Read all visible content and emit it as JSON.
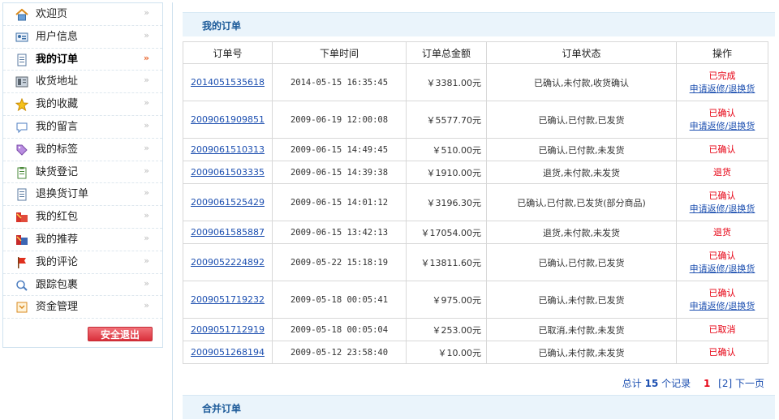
{
  "sidebar": {
    "items": [
      {
        "label": "欢迎页",
        "icon": "house-icon",
        "active": false
      },
      {
        "label": "用户信息",
        "icon": "id-card-icon",
        "active": false
      },
      {
        "label": "我的订单",
        "icon": "document-icon",
        "active": true
      },
      {
        "label": "收货地址",
        "icon": "address-book-icon",
        "active": false
      },
      {
        "label": "我的收藏",
        "icon": "star-icon",
        "active": false
      },
      {
        "label": "我的留言",
        "icon": "speech-bubble-icon",
        "active": false
      },
      {
        "label": "我的标签",
        "icon": "tag-icon",
        "active": false
      },
      {
        "label": "缺货登记",
        "icon": "clipboard-icon",
        "active": false
      },
      {
        "label": "退换货订单",
        "icon": "document-icon",
        "active": false
      },
      {
        "label": "我的红包",
        "icon": "red-envelope-icon",
        "active": false
      },
      {
        "label": "我的推荐",
        "icon": "recommend-icon",
        "active": false
      },
      {
        "label": "我的评论",
        "icon": "flag-icon",
        "active": false
      },
      {
        "label": "跟踪包裹",
        "icon": "tracking-icon",
        "active": false
      },
      {
        "label": "资金管理",
        "icon": "wallet-icon",
        "active": false
      }
    ],
    "logout_label": "安全退出"
  },
  "main": {
    "orders_title": "我的订单",
    "merge_title": "合并订单",
    "columns": [
      "订单号",
      "下单时间",
      "订单总金额",
      "订单状态",
      "操作"
    ],
    "rows": [
      {
        "id": "2014051535618",
        "time": "2014-05-15 16:35:45",
        "amount": "￥3381.00元",
        "status": "已确认,未付款,收货确认",
        "action": "已完成",
        "extra": "申请返修/退换货"
      },
      {
        "id": "2009061909851",
        "time": "2009-06-19 12:00:08",
        "amount": "￥5577.70元",
        "status": "已确认,已付款,已发货",
        "action": "已确认",
        "extra": "申请返修/退换货"
      },
      {
        "id": "2009061510313",
        "time": "2009-06-15 14:49:45",
        "amount": "￥510.00元",
        "status": "已确认,已付款,未发货",
        "action": "已确认",
        "extra": ""
      },
      {
        "id": "2009061503335",
        "time": "2009-06-15 14:39:38",
        "amount": "￥1910.00元",
        "status": "退货,未付款,未发货",
        "action": "退货",
        "extra": ""
      },
      {
        "id": "2009061525429",
        "time": "2009-06-15 14:01:12",
        "amount": "￥3196.30元",
        "status": "已确认,已付款,已发货(部分商品)",
        "action": "已确认",
        "extra": "申请返修/退换货"
      },
      {
        "id": "2009061585887",
        "time": "2009-06-15 13:42:13",
        "amount": "￥17054.00元",
        "status": "退货,未付款,未发货",
        "action": "退货",
        "extra": ""
      },
      {
        "id": "2009052224892",
        "time": "2009-05-22 15:18:19",
        "amount": "￥13811.60元",
        "status": "已确认,已付款,已发货",
        "action": "已确认",
        "extra": "申请返修/退换货"
      },
      {
        "id": "2009051719232",
        "time": "2009-05-18 00:05:41",
        "amount": "￥975.00元",
        "status": "已确认,未付款,已发货",
        "action": "已确认",
        "extra": "申请返修/退换货"
      },
      {
        "id": "2009051712919",
        "time": "2009-05-18 00:05:04",
        "amount": "￥253.00元",
        "status": "已取消,未付款,未发货",
        "action": "已取消",
        "extra": ""
      },
      {
        "id": "2009051268194",
        "time": "2009-05-12 23:58:40",
        "amount": "￥10.00元",
        "status": "已确认,未付款,未发货",
        "action": "已确认",
        "extra": ""
      }
    ],
    "pager": {
      "total_prefix": "总计",
      "total_count": "15",
      "total_suffix": "个记录",
      "current": "1",
      "page2": "[2]",
      "next": "下一页"
    }
  },
  "colors": {
    "accent": "#1c5a99",
    "link": "#1c4fb0",
    "status_red": "#e60012",
    "header_bg": "#eaf4fb"
  }
}
